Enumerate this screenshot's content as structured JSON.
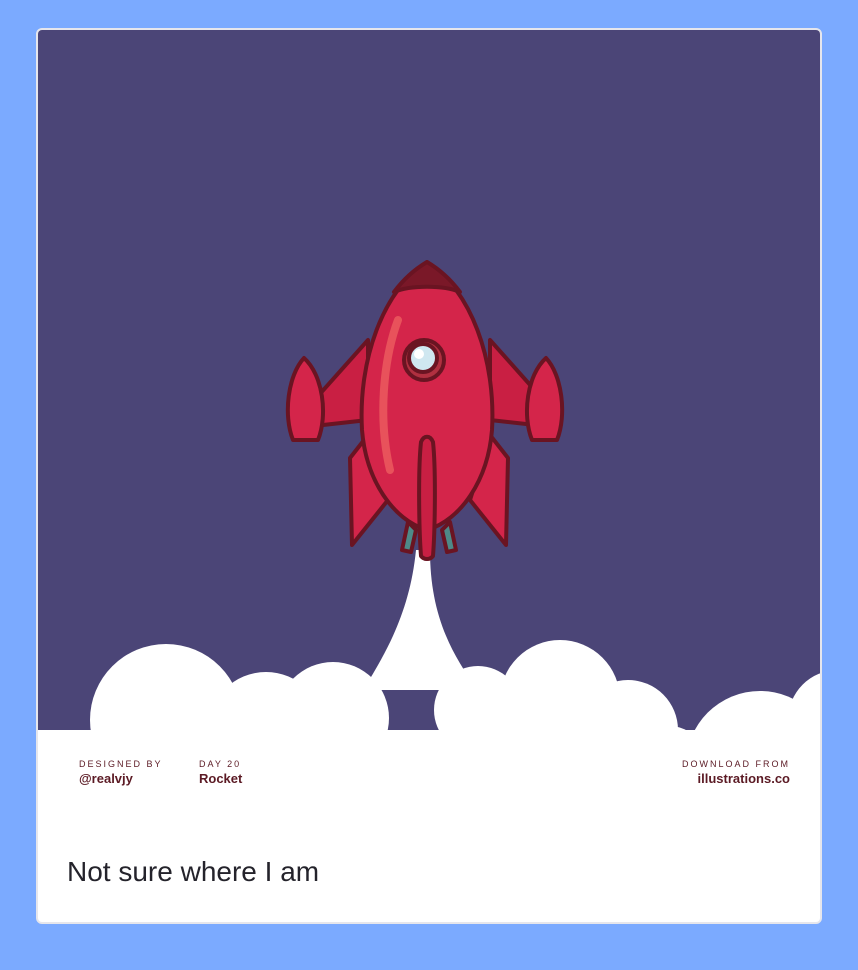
{
  "card": {
    "designer_caption": "DESIGNED BY",
    "designer_handle": "@realvjy",
    "day_caption": "DAY 20",
    "day_title": "Rocket",
    "download_caption": "DOWNLOAD FROM",
    "download_site": "illustrations.co",
    "caption": "Not sure where I am"
  },
  "colors": {
    "page_background": "#7baaff",
    "sky": "#4b4577",
    "rocket_body": "#d4254a",
    "rocket_outline": "#6a1422",
    "cloud": "#ffffff",
    "credit_text": "#5b1a24"
  },
  "illustration": {
    "subject": "rocket-launch-icon"
  }
}
